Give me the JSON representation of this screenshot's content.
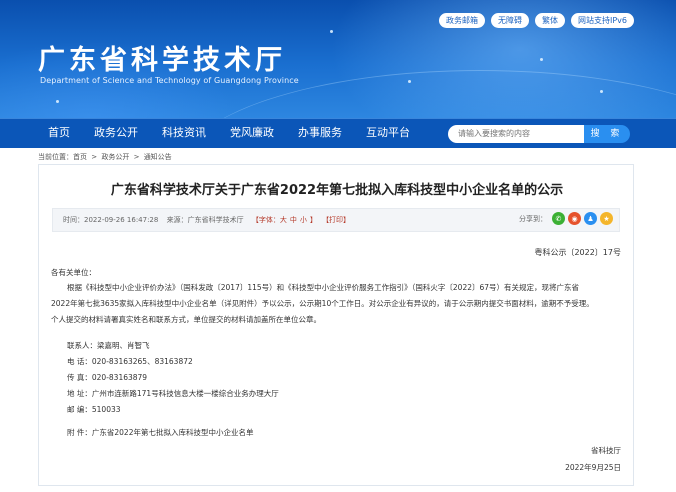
{
  "header": {
    "title": "广东省科学技术厅",
    "subtitle": "Department of Science and Technology of Guangdong Province",
    "top_links": [
      "政务邮箱",
      "无障碍",
      "繁体",
      "网站支持IPv6"
    ]
  },
  "nav": {
    "items": [
      "首页",
      "政务公开",
      "科技资讯",
      "党风廉政",
      "办事服务",
      "互动平台"
    ],
    "search_placeholder": "请输入要搜索的内容",
    "search_button": "搜 索"
  },
  "breadcrumb": [
    "当前位置：首页",
    ">",
    "政务公开",
    ">",
    "通知公告"
  ],
  "article": {
    "title": "广东省科学技术厅关于广东省2022年第七批拟入库科技型中小企业名单的公示",
    "meta": {
      "time": "时间：2022-09-26 16:47:28",
      "source": "来源：广东省科学技术厅",
      "font_label": "【字体：",
      "font_large": "大",
      "font_medium": "中",
      "font_small": "小",
      "font_end": "】",
      "print": "【打印】",
      "share_label": "分享到："
    },
    "share_icons": [
      {
        "name": "wechat-icon",
        "glyph": "✆",
        "color": "#3cb034"
      },
      {
        "name": "weibo-icon",
        "glyph": "◉",
        "color": "#e6522c"
      },
      {
        "name": "qq-icon",
        "glyph": "♟",
        "color": "#2a8ff0"
      },
      {
        "name": "favorite-icon",
        "glyph": "★",
        "color": "#f4b52b"
      }
    ],
    "doc_number": "粤科公示〔2022〕17号",
    "greeting": "各有关单位：",
    "paragraph_lines": [
      "根据《科技型中小企业评价办法》（国科发政〔2017〕115号）和《科技型中小企业评价服务工作指引》（国科火字〔2022〕67号）有关规定，现将广东省",
      "2022年第七批3635家拟入库科技型中小企业名单（详见附件）予以公示，公示期10个工作日。对公示企业有异议的，请于公示期内提交书面材料，逾期不予受理。",
      "个人提交的材料请署真实姓名和联系方式，单位提交的材料请加盖所在单位公章。"
    ],
    "contacts": [
      "联系人：梁嘉明、肖智飞",
      "电  话：020-83163265、83163872",
      "传  真：020-83163879",
      "地  址：广州市连新路171号科技信息大楼一楼综合业务办理大厅",
      "邮  编：510033"
    ],
    "attachment": "附  件：广东省2022年第七批拟入库科技型中小企业名单",
    "signature": "省科技厅",
    "date": "2022年9月25日"
  }
}
